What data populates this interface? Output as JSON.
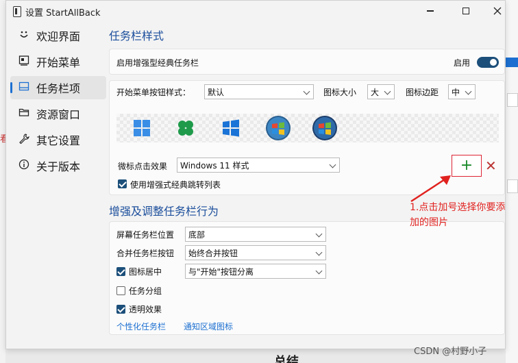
{
  "window": {
    "title": "设置 StartAllBack"
  },
  "sidebar": {
    "items": [
      {
        "label": "欢迎界面",
        "icon": "smiley-icon"
      },
      {
        "label": "开始菜单",
        "icon": "start-menu-icon"
      },
      {
        "label": "任务栏项",
        "icon": "taskbar-icon"
      },
      {
        "label": "资源窗口",
        "icon": "folder-icon"
      },
      {
        "label": "其它设置",
        "icon": "wrench-icon"
      },
      {
        "label": "关于版本",
        "icon": "info-icon"
      }
    ]
  },
  "taskbar_style": {
    "title": "任务栏样式",
    "enhanced_label": "启用增强型经典任务栏",
    "enable_label": "启用",
    "start_btn_label": "开始菜单按钮样式：",
    "start_btn_value": "默认",
    "icon_size_label": "图标大小",
    "icon_size_value": "大",
    "icon_margin_label": "图标边距",
    "icon_margin_value": "中",
    "click_effect_label": "微标点击效果",
    "click_effect_value": "Windows 11 样式",
    "jumplist_label": "使用增强式经典跳转列表",
    "add_button": "+",
    "remove_button": "✕"
  },
  "behavior": {
    "title": "增强及调整任务栏行为",
    "position_label": "屏幕任务栏位置",
    "position_value": "底部",
    "merge_label": "合并任务栏按钮",
    "merge_value": "始终合并按钮",
    "center_label": "图标居中",
    "center_value": "与\"开始\"按钮分离",
    "group_label": "任务分组",
    "transparent_label": "透明效果",
    "link_personalize": "个性化任务栏",
    "link_tray": "通知区域图标"
  },
  "annotation": {
    "text": "1.点击加号选择你要添加的图片"
  },
  "watermark": "CSDN @村野小子",
  "colors": {
    "accent": "#1c4f7a",
    "title_blue": "#1a4d9b",
    "annotation_red": "#e0221f"
  }
}
